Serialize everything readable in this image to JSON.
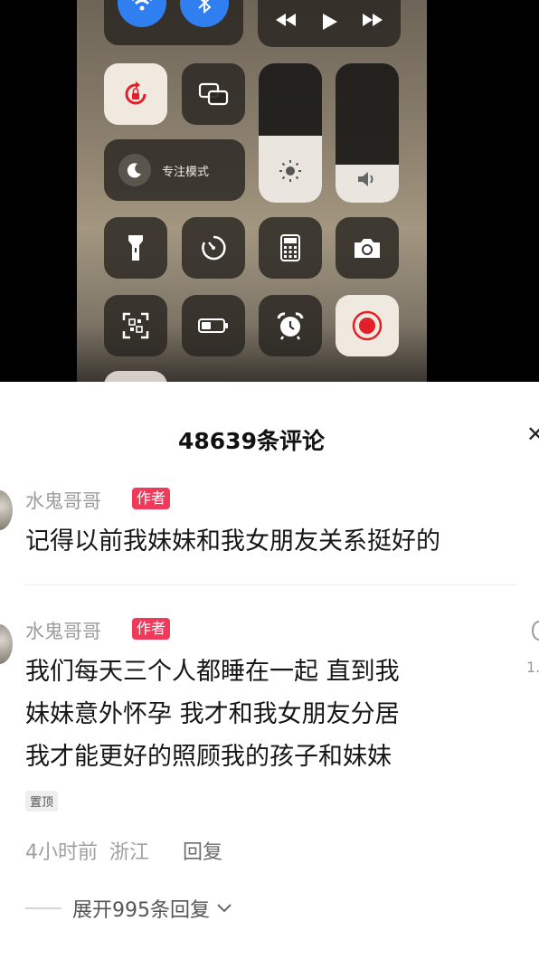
{
  "control_center": {
    "focus_label": "专注模式",
    "brightness_level": 0.48,
    "volume_level": 0.27,
    "accent_color": "#2f7ff0",
    "record_color": "#e3202a",
    "icons": [
      "wifi-icon",
      "bluetooth-icon",
      "rewind-icon",
      "play-icon",
      "fast-forward-icon",
      "rotation-lock-icon",
      "screen-mirror-icon",
      "moon-icon",
      "sun-icon",
      "speaker-icon",
      "flashlight-icon",
      "timer-icon",
      "calculator-icon",
      "camera-icon",
      "qr-scan-icon",
      "low-power-icon",
      "alarm-icon",
      "screen-record-icon"
    ]
  },
  "comments_panel": {
    "title": "48639条评论",
    "author_badge": "作者",
    "badge_color": "#f03a5c",
    "comments": [
      {
        "username": "水鬼哥哥",
        "text_lines": [
          "记得以前我妹妹和我女朋友关系挺好的"
        ]
      },
      {
        "username": "水鬼哥哥",
        "text_lines": [
          "我们每天三个人都睡在一起 直到我",
          "妹妹意外怀孕 我才和我女朋友分居",
          "我才能更好的照顾我的孩子和妹妹"
        ],
        "pin_label": "置顶",
        "time": "4小时前",
        "location": "浙江",
        "reply_label": "回复",
        "expand_label": "展开995条回复",
        "like_count_partial": "1."
      }
    ]
  }
}
